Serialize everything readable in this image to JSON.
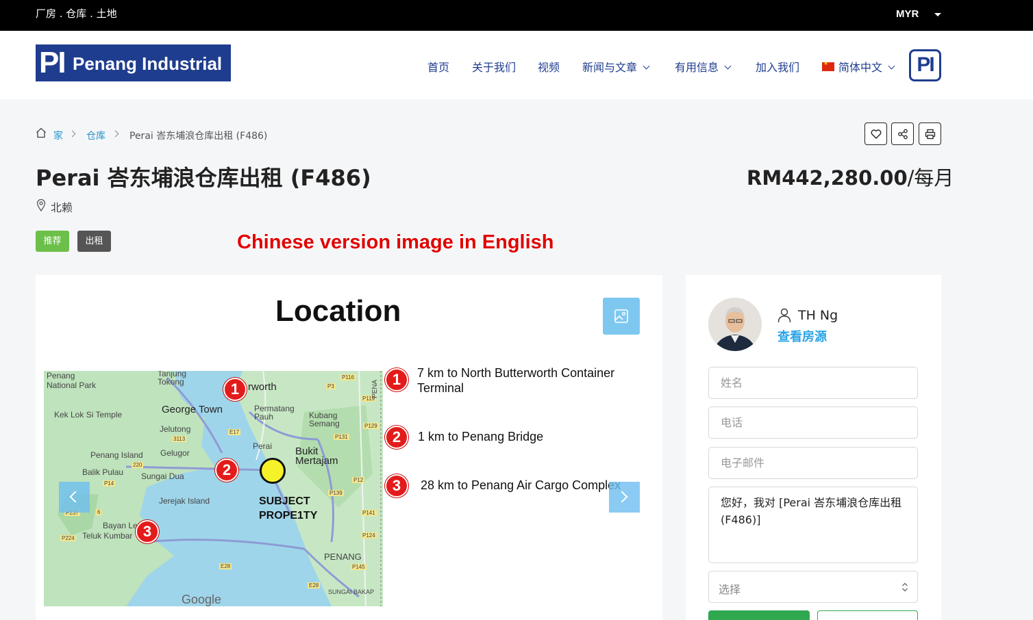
{
  "topbar": {
    "tagline": "厂房 . 仓库 . 土地",
    "currency": "MYR"
  },
  "logo": {
    "mark": "PI",
    "name": "Penang Industrial"
  },
  "nav": {
    "items": [
      {
        "label": "首页"
      },
      {
        "label": "关于我们"
      },
      {
        "label": "视频"
      },
      {
        "label": "新闻与文章"
      },
      {
        "label": "有用信息"
      },
      {
        "label": "加入我们"
      },
      {
        "label": "简体中文"
      }
    ]
  },
  "breadcrumb": {
    "home": "家",
    "category": "仓库",
    "current": "Perai 峇东埔浪仓库出租 (F486)"
  },
  "listing": {
    "title": "Perai 峇东埔浪仓库出租 (F486)",
    "price": "RM442,280.00",
    "price_unit": "/每月",
    "location": "北赖",
    "badges": [
      "推荐",
      "出租"
    ]
  },
  "banner_note": "Chinese version image in English",
  "gallery": {
    "heading": "Location",
    "map_labels": {
      "penang_park": "Penang\nNational Park",
      "tanjung": "Tanjung\nTokong",
      "butterworth": "rworth",
      "kek_lok": "Kek Lok Si Temple",
      "george_town": "George Town",
      "permatang": "Permatang\nPauh",
      "kubang": "Kubang\nSemang",
      "jelutong": "Jelutong",
      "penang_island": "Penang Island",
      "gelugor": "Gelugor",
      "perai": "Perai",
      "bukit": "Bukit\nMertajam",
      "balik": "Balik Pulau",
      "sungai_dua": "Sungai Dua",
      "jerejak": "Jerejak Island",
      "bayan": "Bayan Le",
      "teluk": "Teluk Kumbar",
      "subject": "SUBJECT\nPROPE1TY",
      "penang": "PENANG",
      "sungai_bakap": "SUNGAI BAKAP",
      "google": "Google",
      "road_p116": "P116",
      "road_p3": "P3",
      "road_p119": "P119",
      "road_e17": "E17",
      "road_p129": "P129",
      "road_p131": "P131",
      "road_3113": "3113",
      "road_220": "220",
      "road_p14": "P14",
      "road_p12": "P12",
      "road_p139": "P139",
      "road_p237": "P237",
      "road_6": "6",
      "road_p141": "P141",
      "road_p224": "P224",
      "road_p124": "P124",
      "road_e28a": "E28",
      "road_p145": "P145",
      "road_e28b": "E28",
      "road_pena": "PENA"
    },
    "notes": [
      {
        "num": "1",
        "text": "7 km to North Butterworth Container Terminal"
      },
      {
        "num": "2",
        "text": "1 km to Penang Bridge"
      },
      {
        "num": "3",
        "text": "28 km to Penang Air Cargo Complex"
      }
    ]
  },
  "agent": {
    "name": "TH Ng",
    "link": "查看房源",
    "name_placeholder": "姓名",
    "phone_placeholder": "电话",
    "email_placeholder": "电子邮件",
    "message_value": "您好，我对 [Perai 峇东埔浪仓库出租 (F486)]",
    "select_placeholder": "选择"
  },
  "colors": {
    "brand": "#1f3d8f",
    "link": "#2593cb",
    "featured": "#6cc04a",
    "rent": "#555555",
    "marker": "#e31b1b"
  }
}
